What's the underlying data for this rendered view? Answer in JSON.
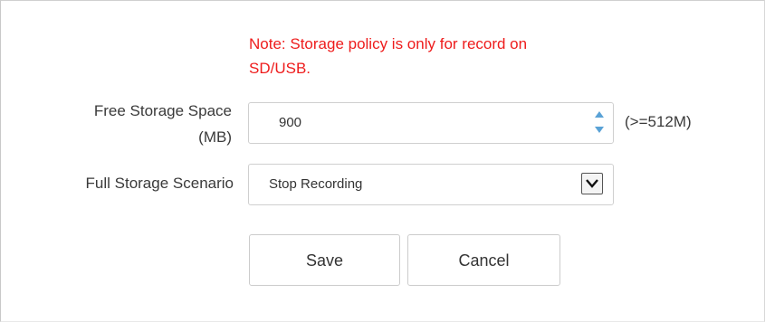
{
  "note": {
    "line1": "Note: Storage policy is only for record on",
    "line2": "SD/USB.",
    "color": "#ee1c1c"
  },
  "free_storage": {
    "label_line1": "Free Storage Space",
    "label_line2": "(MB)",
    "value": "900",
    "hint": "(>=512M)",
    "spinner_icon": "up-down-arrows-icon"
  },
  "full_storage": {
    "label": "Full Storage Scenario",
    "selected": "Stop Recording",
    "dropdown_icon": "chevron-down-icon"
  },
  "buttons": {
    "save_label": "Save",
    "cancel_label": "Cancel"
  }
}
